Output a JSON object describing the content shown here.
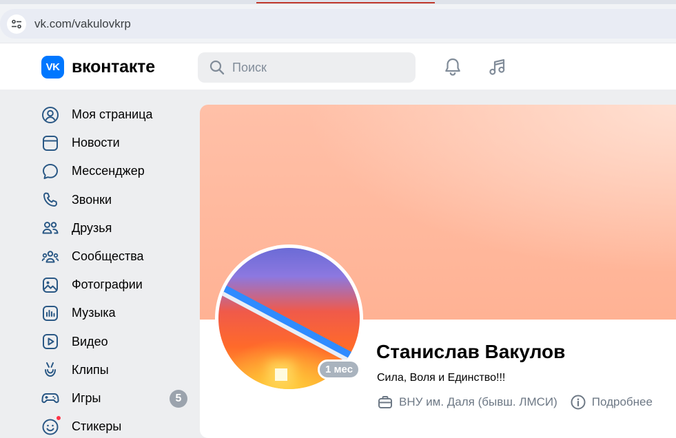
{
  "browser": {
    "url": "vk.com/vakulovkrp"
  },
  "header": {
    "logo_text": "вконтакте",
    "logo_badge": "VK",
    "search_placeholder": "Поиск"
  },
  "menu": {
    "items": [
      {
        "label": "Моя страница",
        "icon": "user-circle-icon"
      },
      {
        "label": "Новости",
        "icon": "newsfeed-icon"
      },
      {
        "label": "Мессенджер",
        "icon": "message-icon"
      },
      {
        "label": "Звонки",
        "icon": "phone-icon"
      },
      {
        "label": "Друзья",
        "icon": "friends-icon"
      },
      {
        "label": "Сообщества",
        "icon": "communities-icon"
      },
      {
        "label": "Фотографии",
        "icon": "photos-icon"
      },
      {
        "label": "Музыка",
        "icon": "music-chart-icon"
      },
      {
        "label": "Видео",
        "icon": "video-icon"
      },
      {
        "label": "Клипы",
        "icon": "clips-icon"
      },
      {
        "label": "Игры",
        "icon": "gamepad-icon",
        "count": "5"
      },
      {
        "label": "Стикеры",
        "icon": "sticker-icon"
      }
    ]
  },
  "profile": {
    "name": "Станислав Вакулов",
    "status": "Сила, Воля и Единство!!!",
    "online": "1 мес",
    "education": "ВНУ им. Даля (бывш. ЛМСИ)",
    "details_label": "Подробнее"
  },
  "colors": {
    "accent": "#0077ff",
    "icon": "#2a5885",
    "secondary_text": "#6d7885",
    "badge": "#9ba3ad"
  }
}
